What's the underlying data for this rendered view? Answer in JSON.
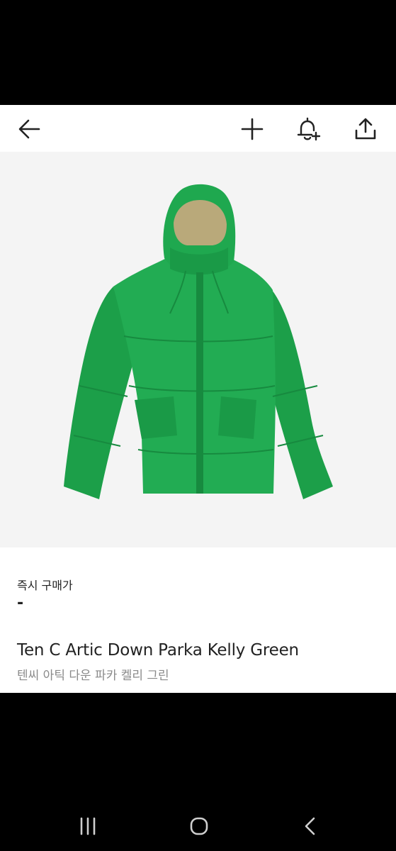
{
  "toolbar": {
    "back_icon": "arrow-left-icon",
    "add_icon": "plus-icon",
    "alert_icon": "bell-plus-icon",
    "share_icon": "share-upload-icon"
  },
  "product": {
    "image_description_color": "#1fa84f",
    "price_label": "즉시 구매가",
    "price_value": "-",
    "name_en": "Ten C Artic Down Parka Kelly Green",
    "name_ko": "텐씨 아틱 다운 파카 켈리 그린"
  },
  "system_nav": {
    "recents_icon": "recents-icon",
    "home_icon": "home-icon",
    "back_icon": "back-chevron-icon"
  },
  "colors": {
    "jacket_green": "#1fa84f",
    "hood_lining": "#b9a97a",
    "image_background": "#f4f4f4"
  }
}
